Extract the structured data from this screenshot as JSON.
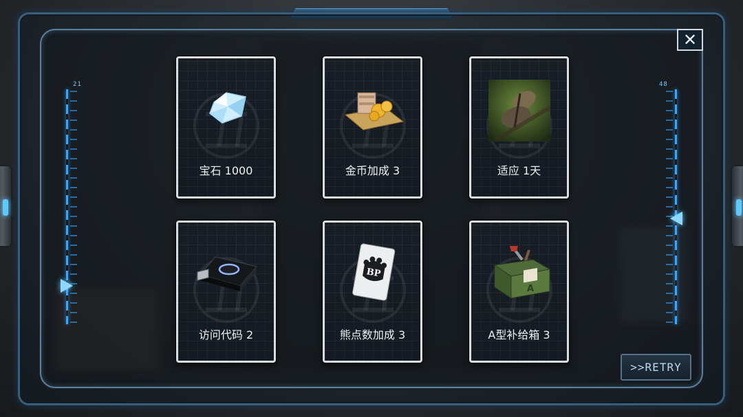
{
  "gauges": {
    "left_value": "21",
    "right_value": "48"
  },
  "close_button": {
    "glyph": "✕"
  },
  "rewards": [
    {
      "label": "宝石 1000",
      "icon": "gem-icon"
    },
    {
      "label": "金币加成 3",
      "icon": "gold-coins-icon"
    },
    {
      "label": "适应 1天",
      "icon": "moth-adaptation-icon"
    },
    {
      "label": "访问代码 2",
      "icon": "usb-drive-icon"
    },
    {
      "label": "熊点数加成 3",
      "icon": "bp-card-icon"
    },
    {
      "label": "A型补给箱 3",
      "icon": "supply-crate-icon"
    }
  ],
  "retry": {
    "label": ">>RETRY"
  },
  "colors": {
    "accent": "#5fc9ff",
    "card_border": "#d9dde0",
    "frame": "#3a5d7a"
  }
}
